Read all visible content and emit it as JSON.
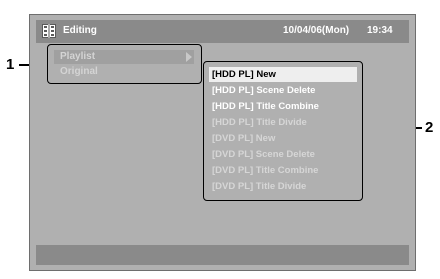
{
  "header": {
    "title": "Editing",
    "date": "10/04/06(Mon)",
    "time": "19:34",
    "icon": "edit-icon"
  },
  "left_menu": {
    "items": [
      {
        "label": "Playlist",
        "has_submenu": true
      },
      {
        "label": "Original",
        "has_submenu": false
      }
    ]
  },
  "right_menu": {
    "items": [
      {
        "label": "[HDD PL] New",
        "state": "selected"
      },
      {
        "label": "[HDD PL] Scene Delete",
        "state": "active"
      },
      {
        "label": "[HDD PL] Title Combine",
        "state": "active"
      },
      {
        "label": "[HDD PL] Title Divide",
        "state": "inactive"
      },
      {
        "label": "[DVD PL] New",
        "state": "inactive"
      },
      {
        "label": "[DVD PL] Scene Delete",
        "state": "inactive"
      },
      {
        "label": "[DVD PL] Title Combine",
        "state": "inactive"
      },
      {
        "label": "[DVD PL] Title Divide",
        "state": "inactive"
      }
    ]
  },
  "callouts": {
    "left": "1",
    "right": "2"
  },
  "colors": {
    "screen_bg": "#b0b0b0",
    "bar_bg": "#8a8a8a",
    "highlight_bg": "#eeeeee",
    "text_active": "#ffffff",
    "text_inactive": "#d6d6d6"
  }
}
